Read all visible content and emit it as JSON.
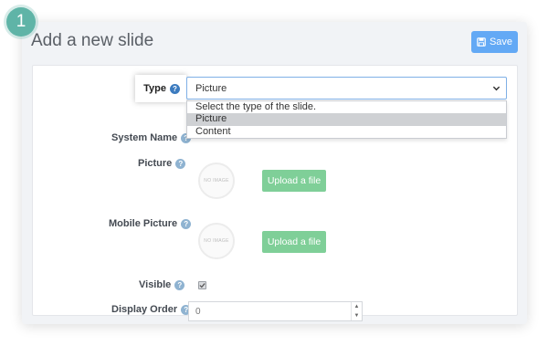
{
  "step": "1",
  "card": {
    "title": "Add a new slide"
  },
  "toolbar": {
    "save_label": "Save"
  },
  "form": {
    "type": {
      "label": "Type",
      "value": "Picture",
      "options": [
        "Select the type of the slide.",
        "Picture",
        "Content"
      ],
      "selected_index": 1
    },
    "system_name": {
      "label": "System Name"
    },
    "picture": {
      "label": "Picture",
      "placeholder_image": "NO IMAGE",
      "upload_label": "Upload a file"
    },
    "mobile_picture": {
      "label": "Mobile Picture",
      "placeholder_image": "NO IMAGE",
      "upload_label": "Upload a file"
    },
    "visible": {
      "label": "Visible",
      "checked": true
    },
    "display_order": {
      "label": "Display Order",
      "value": "0"
    }
  },
  "colors": {
    "badge": "#5fb4a7",
    "save_button": "#63a9f5",
    "upload_button": "#7fcf98",
    "help_icon": "#8fb3d1"
  },
  "icons": [
    "save-icon",
    "help-icon",
    "chevron-down-icon",
    "check-icon",
    "no-image-icon",
    "spin-up-icon",
    "spin-down-icon"
  ]
}
